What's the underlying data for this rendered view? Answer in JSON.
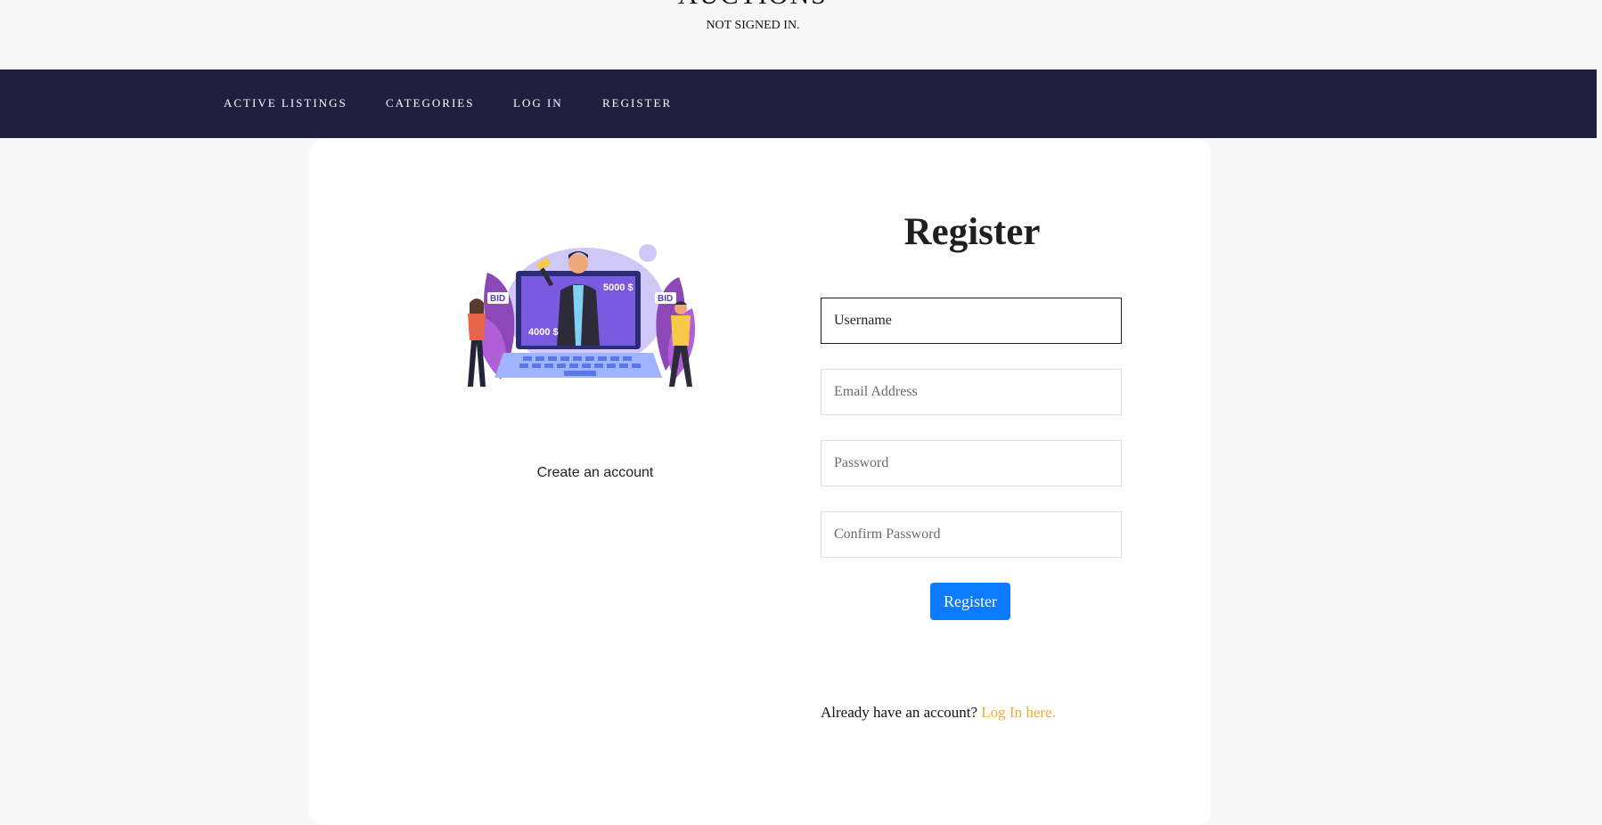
{
  "header": {
    "site_title": "AUCTIONS",
    "status": "NOT SIGNED IN."
  },
  "nav": {
    "items": [
      {
        "label": "ACTIVE LISTINGS"
      },
      {
        "label": "CATEGORIES"
      },
      {
        "label": "LOG IN"
      },
      {
        "label": "REGISTER"
      }
    ]
  },
  "left_panel": {
    "illustration_icon": "auction-laptop-illustration",
    "illustration_labels": {
      "bid_left": "BID",
      "bid_right": "BID",
      "price_high": "5000 $",
      "price_low": "4000 $"
    },
    "caption": "Create an account"
  },
  "form": {
    "title": "Register",
    "username_placeholder": "Username",
    "email_placeholder": "Email Address",
    "password_placeholder": "Password",
    "confirm_password_placeholder": "Confirm Password",
    "submit_label": "Register",
    "footer_text": "Already have an account? ",
    "footer_link": "Log In here."
  },
  "colors": {
    "navbar": "#1f2041",
    "button": "#0d7bff",
    "link": "#f2a93b",
    "background": "#f8f8f8"
  }
}
